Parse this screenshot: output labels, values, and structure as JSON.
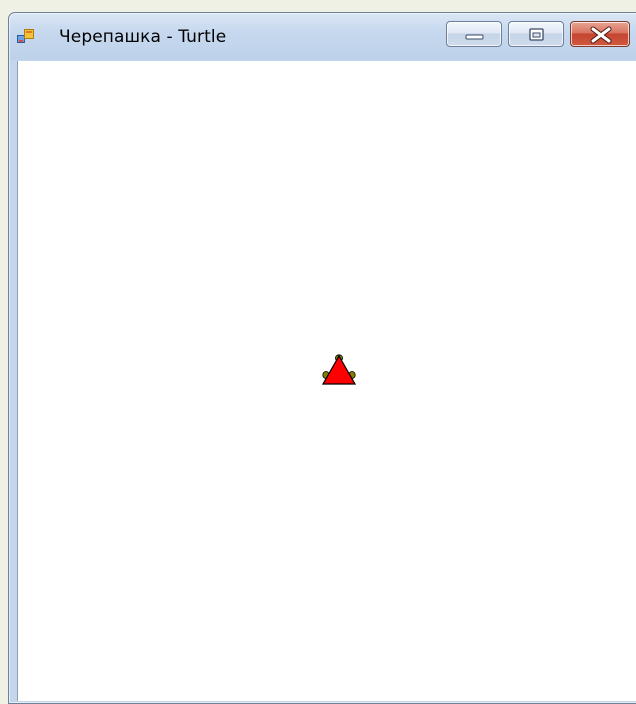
{
  "window": {
    "title": "Черепашка - Turtle",
    "icon": "windows-form-icon"
  },
  "caption_buttons": {
    "minimize": "minimize-icon",
    "maximize": "restore-icon",
    "close": "close-icon"
  },
  "canvas": {
    "background": "#ffffff",
    "turtle": {
      "shape": "triangle",
      "heading": "up",
      "fill_color": "#ff0000",
      "outline_color": "#000000",
      "leg_color": "#7f7f00"
    }
  }
}
